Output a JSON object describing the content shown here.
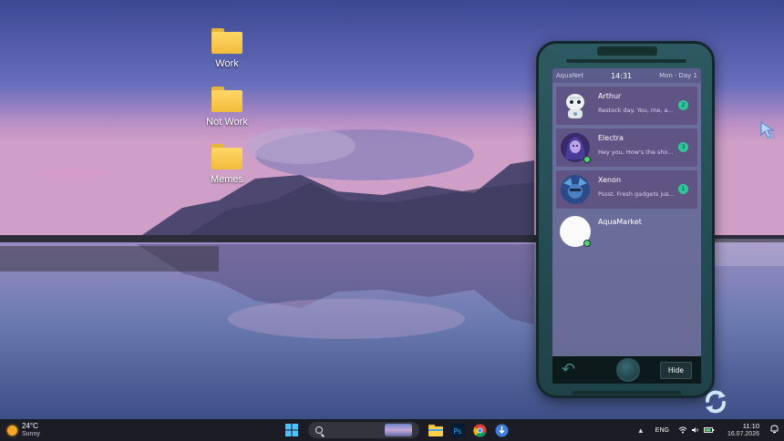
{
  "desktop": {
    "icons": [
      {
        "label": "Work"
      },
      {
        "label": "Not Work"
      },
      {
        "label": "Memes"
      }
    ]
  },
  "phone": {
    "status": {
      "carrier": "AquaNet",
      "time": "14:31",
      "day": "Mon · Day 1"
    },
    "chats": [
      {
        "name": "Arthur",
        "preview": "Restock day. You, me, a...",
        "badge": "2",
        "online": false,
        "avatar": "robot-avatar"
      },
      {
        "name": "Electra",
        "preview": "Hey you. How's the sho...",
        "badge": "3",
        "online": true,
        "avatar": "electra-avatar"
      },
      {
        "name": "Xenon",
        "preview": "Pssst. Fresh gadgets just...",
        "badge": "1",
        "online": false,
        "avatar": "xenon-avatar"
      },
      {
        "name": "AquaMarket",
        "preview": "",
        "badge": "",
        "online": true,
        "avatar": "aquamarket-avatar"
      }
    ],
    "nav": {
      "hide_label": "Hide"
    }
  },
  "taskbar": {
    "weather": {
      "temp": "24°C",
      "condition": "Sunny"
    },
    "tray": {
      "language": "ENG",
      "time": "11:10",
      "date": "16.07.2026"
    },
    "apps": [
      "start-icon",
      "search-box",
      "file-explorer-icon",
      "photoshop-icon",
      "chrome-icon",
      "app-icon"
    ]
  },
  "colors": {
    "accent": "#2fc59a",
    "online": "#4cd964",
    "phone_body": "#2d5a62",
    "taskbar": "#1c1c26"
  }
}
